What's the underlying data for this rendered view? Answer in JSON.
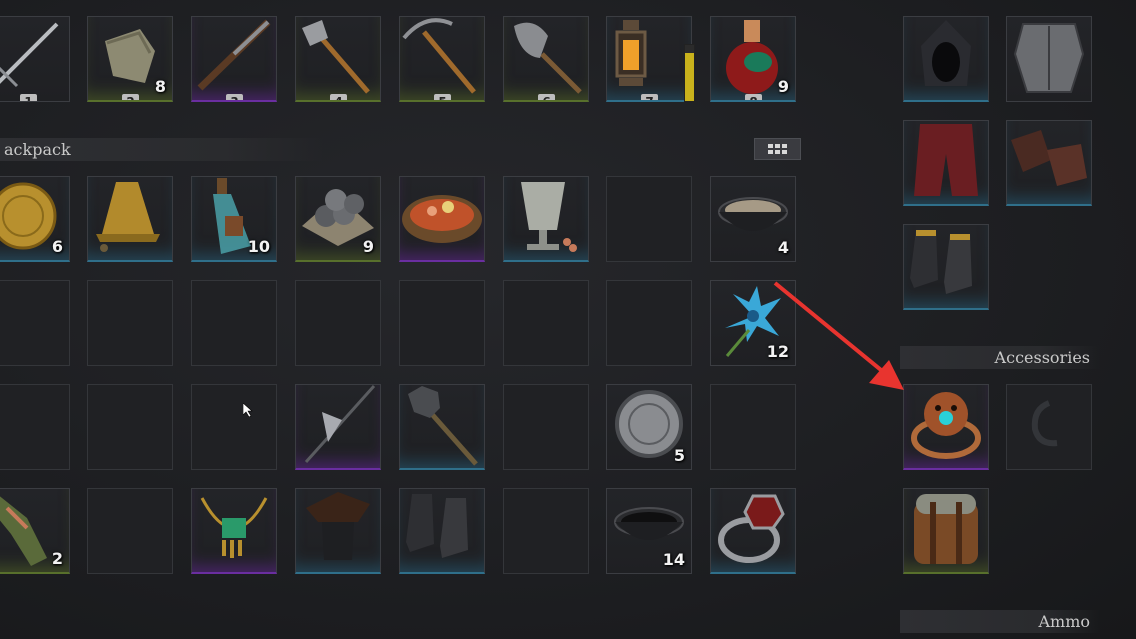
{
  "hotbar": [
    {
      "key": "1",
      "qty": "",
      "icon": "sword-icon",
      "rarity": "none"
    },
    {
      "key": "2",
      "qty": "8",
      "icon": "bandage-icon",
      "rarity": "common"
    },
    {
      "key": "3",
      "qty": "",
      "icon": "musket-icon",
      "rarity": "rare"
    },
    {
      "key": "4",
      "qty": "",
      "icon": "axe-icon",
      "rarity": "common"
    },
    {
      "key": "5",
      "qty": "",
      "icon": "pickaxe-icon",
      "rarity": "common"
    },
    {
      "key": "6",
      "qty": "",
      "icon": "shovel-icon",
      "rarity": "common"
    },
    {
      "key": "7",
      "qty": "",
      "icon": "lantern-icon",
      "rarity": "uncommon"
    },
    {
      "key": "8",
      "qty": "9",
      "icon": "potion-icon",
      "rarity": "uncommon"
    }
  ],
  "backpack": {
    "title": "ackpack",
    "rows": [
      [
        {
          "qty": "6",
          "icon": "gold-coin-icon",
          "rarity": "uncommon"
        },
        {
          "qty": "",
          "icon": "bell-icon",
          "rarity": "uncommon"
        },
        {
          "qty": "10",
          "icon": "bottle-icon",
          "rarity": "uncommon"
        },
        {
          "qty": "9",
          "icon": "cannonballs-icon",
          "rarity": "common"
        },
        {
          "qty": "",
          "icon": "food-platter-icon",
          "rarity": "rare"
        },
        {
          "qty": "",
          "icon": "milk-glass-icon",
          "rarity": "uncommon"
        },
        {
          "qty": "",
          "icon": "",
          "rarity": "empty"
        },
        {
          "qty": "4",
          "icon": "powder-bowl-icon",
          "rarity": "none"
        }
      ],
      [
        {
          "qty": "",
          "icon": "",
          "rarity": "empty"
        },
        {
          "qty": "",
          "icon": "",
          "rarity": "empty"
        },
        {
          "qty": "",
          "icon": "",
          "rarity": "empty"
        },
        {
          "qty": "",
          "icon": "",
          "rarity": "empty"
        },
        {
          "qty": "",
          "icon": "",
          "rarity": "empty"
        },
        {
          "qty": "",
          "icon": "",
          "rarity": "empty"
        },
        {
          "qty": "",
          "icon": "",
          "rarity": "empty"
        },
        {
          "qty": "12",
          "icon": "blue-flower-icon",
          "rarity": "none"
        }
      ],
      [
        {
          "qty": "",
          "icon": "",
          "rarity": "empty"
        },
        {
          "qty": "",
          "icon": "",
          "rarity": "empty"
        },
        {
          "qty": "",
          "icon": "",
          "rarity": "empty"
        },
        {
          "qty": "",
          "icon": "halberd-icon",
          "rarity": "rare"
        },
        {
          "qty": "",
          "icon": "mace-icon",
          "rarity": "uncommon"
        },
        {
          "qty": "",
          "icon": "",
          "rarity": "empty"
        },
        {
          "qty": "5",
          "icon": "silver-coin-icon",
          "rarity": "none"
        },
        {
          "qty": "",
          "icon": "",
          "rarity": "empty"
        }
      ],
      [
        {
          "qty": "2",
          "icon": "crocodile-icon",
          "rarity": "common"
        },
        {
          "qty": "",
          "icon": "",
          "rarity": "empty"
        },
        {
          "qty": "",
          "icon": "jade-necklace-icon",
          "rarity": "rare"
        },
        {
          "qty": "",
          "icon": "tricorn-hat-icon",
          "rarity": "uncommon"
        },
        {
          "qty": "",
          "icon": "boots-icon",
          "rarity": "uncommon"
        },
        {
          "qty": "",
          "icon": "",
          "rarity": "empty"
        },
        {
          "qty": "14",
          "icon": "tar-bowl-icon",
          "rarity": "none"
        },
        {
          "qty": "",
          "icon": "signet-ring-icon",
          "rarity": "uncommon"
        }
      ]
    ]
  },
  "equipment": [
    {
      "icon": "hood-icon",
      "rarity": "uncommon"
    },
    {
      "icon": "armor-icon",
      "rarity": "none"
    },
    {
      "icon": "pants-icon",
      "rarity": "uncommon"
    },
    {
      "icon": "gloves-icon",
      "rarity": "uncommon"
    },
    {
      "icon": "equip-boots-icon",
      "rarity": "uncommon"
    }
  ],
  "accessories": {
    "title": "Accessories",
    "items": [
      {
        "icon": "tiger-ring-icon",
        "rarity": "rare"
      },
      {
        "icon": "empty-ring-slot-icon",
        "rarity": "empty"
      },
      {
        "icon": "bedroll-icon",
        "rarity": "common"
      }
    ]
  },
  "ammo": {
    "title": "Ammo"
  },
  "colors": {
    "common": "#58702c",
    "uncommon": "#2f6f8a",
    "rare": "#6a2ea0",
    "arrow": "#e8342f"
  }
}
